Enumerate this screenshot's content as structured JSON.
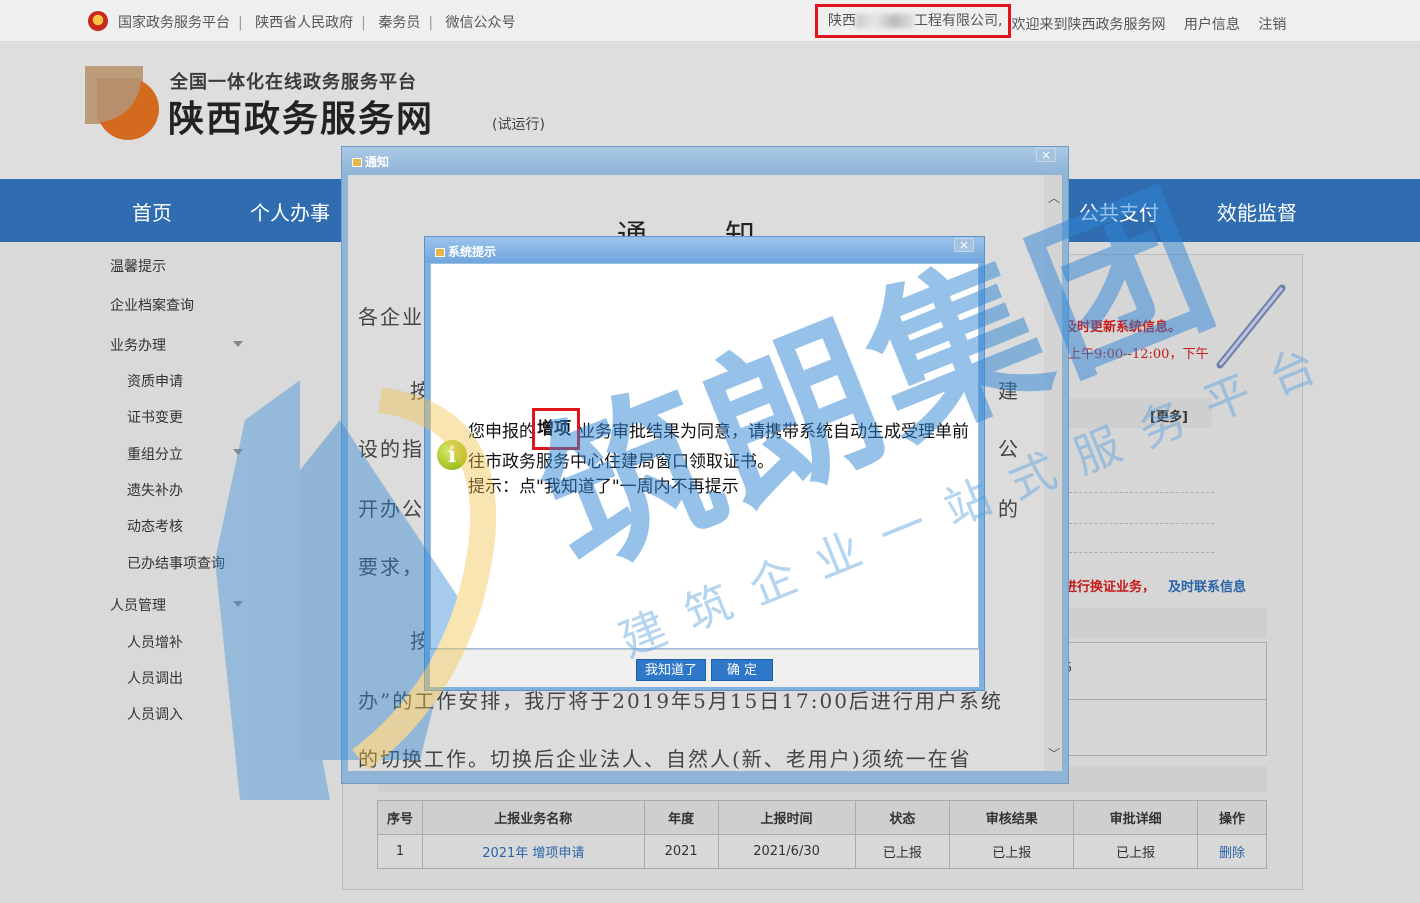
{
  "topbar": {
    "links": [
      "国家政务服务平台",
      "陕西省人民政府",
      "秦务员",
      "微信公众号"
    ],
    "company_prefix": "陕西",
    "company_suffix": "工程有限公司,",
    "welcome": "欢迎来到陕西政务服务网",
    "user_info": "用户信息",
    "logout": "注销"
  },
  "header": {
    "subtitle": "全国一体化在线政务服务平台",
    "title": "陕西政务服务网",
    "trial": "(试运行)"
  },
  "nav": [
    "首页",
    "个人办事",
    "公共支付",
    "效能监督"
  ],
  "sidebar": {
    "items": [
      {
        "label": "温馨提示"
      },
      {
        "label": "企业档案查询"
      },
      {
        "label": "业务办理"
      },
      {
        "label": "资质申请"
      },
      {
        "label": "证书变更"
      },
      {
        "label": "重组分立"
      },
      {
        "label": "遗失补办"
      },
      {
        "label": "动态考核"
      },
      {
        "label": "已办结事项查询"
      },
      {
        "label": "人员管理"
      },
      {
        "label": "人员增补"
      },
      {
        "label": "人员调出"
      },
      {
        "label": "人员调入"
      }
    ]
  },
  "content": {
    "red1": "及时更新系统信息。",
    "red2": "上午9:00--12:00，下午",
    "more": "[更多]",
    "red3": "进行换证业务，",
    "blue3": "及时联系信息",
    "partial_digit": "5"
  },
  "table": {
    "headers": [
      "序号",
      "上报业务名称",
      "年度",
      "上报时间",
      "状态",
      "审核结果",
      "审批详细",
      "操作"
    ],
    "rows": [
      [
        "1",
        "2021年 增项申请",
        "2021",
        "2021/6/30",
        "已上报",
        "已上报",
        "已上报",
        "删除"
      ]
    ]
  },
  "notice": {
    "window_title": "通知",
    "close": "×",
    "doc_title": "通　知",
    "lines": [
      "各企业",
      "按",
      "设的指",
      "开办公",
      "要求，",
      "按",
      "办”的工作安排，我厅将于2019年5月15日17:00后进行用户系统",
      "的切换工作。切换后企业法人、自然人(新、老用户)须统一在省"
    ],
    "right_fragments": [
      "建",
      "公",
      "的"
    ]
  },
  "dialog": {
    "window_title": "系统提示",
    "close": "×",
    "msg_pre": "您申报的",
    "msg_highlight": "增项",
    "msg_post": "业务审批结果为同意，请携带系统自动生成受理单前",
    "msg_line2": "往市政务服务中心住建局窗口领取证书。",
    "msg_line3": "提示：点\"我知道了\"一周内不再提示",
    "btn_know": "我知道了",
    "btn_ok": "确 定"
  },
  "watermark": {
    "brand": "筑朗集团",
    "slogan": "建筑企业一站式服务平台"
  }
}
